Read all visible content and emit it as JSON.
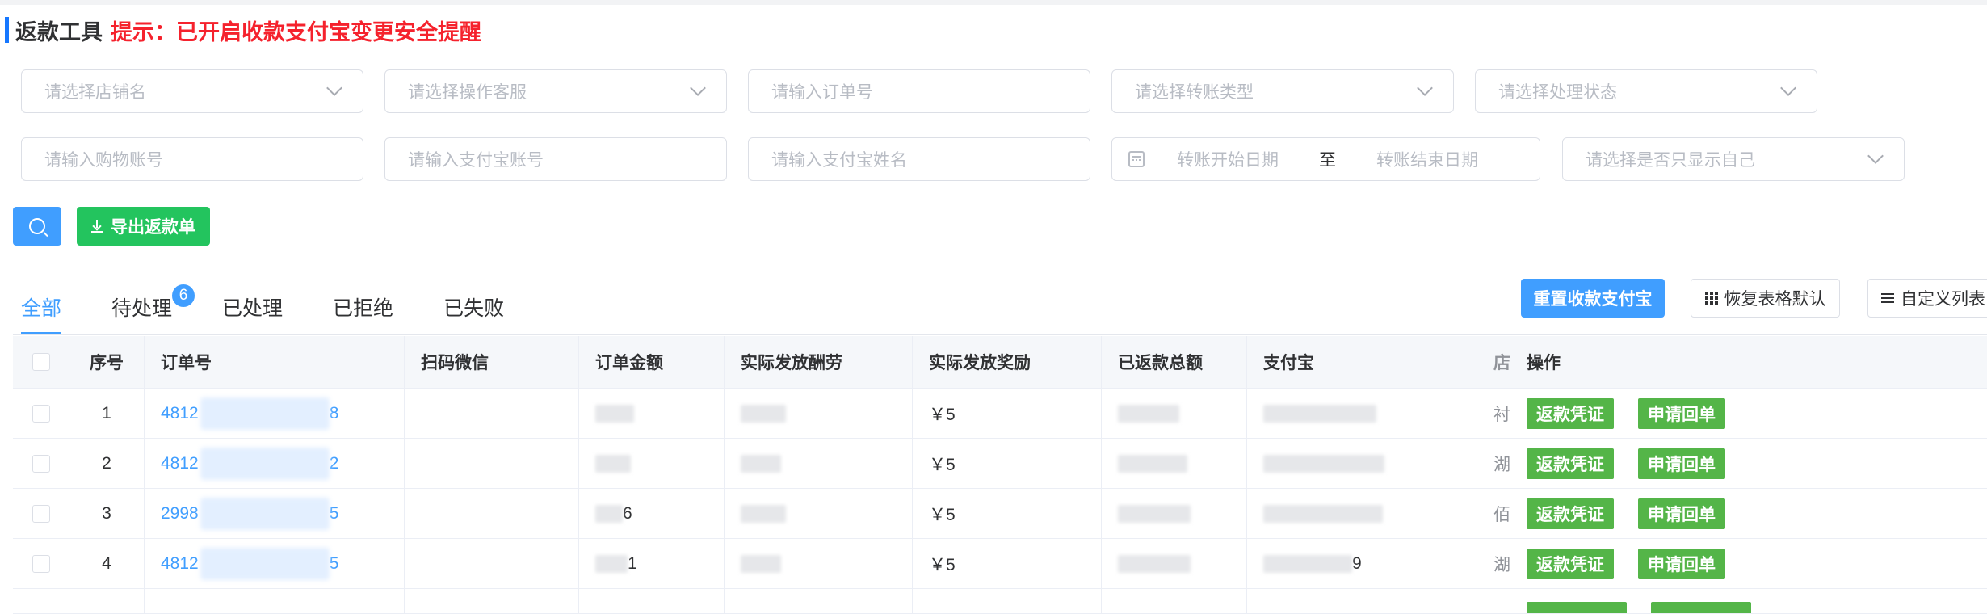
{
  "header": {
    "title": "返款工具",
    "tip": "提示：已开启收款支付宝变更安全提醒"
  },
  "filters": {
    "row1": [
      {
        "name": "shop-select",
        "placeholder": "请选择店铺名",
        "type": "select"
      },
      {
        "name": "operator-select",
        "placeholder": "请选择操作客服",
        "type": "select"
      },
      {
        "name": "order-input",
        "placeholder": "请输入订单号",
        "type": "input"
      },
      {
        "name": "transfer-type-select",
        "placeholder": "请选择转账类型",
        "type": "select"
      },
      {
        "name": "status-select",
        "placeholder": "请选择处理状态",
        "type": "select"
      }
    ],
    "row2": [
      {
        "name": "shopping-account-input",
        "placeholder": "请输入购物账号",
        "type": "input"
      },
      {
        "name": "alipay-account-input",
        "placeholder": "请输入支付宝账号",
        "type": "input"
      },
      {
        "name": "alipay-name-input",
        "placeholder": "请输入支付宝姓名",
        "type": "input"
      }
    ],
    "date_range": {
      "start_placeholder": "转账开始日期",
      "separator": "至",
      "end_placeholder": "转账结束日期"
    },
    "self_only_placeholder": "请选择是否只显示自己"
  },
  "actions": {
    "export_label": "导出返款单",
    "reset_alipay_label": "重置收款支付宝",
    "restore_table_label": "恢复表格默认",
    "custom_list_label": "自定义列表"
  },
  "tabs": [
    {
      "label": "全部",
      "active": true
    },
    {
      "label": "待处理",
      "badge": "6"
    },
    {
      "label": "已处理"
    },
    {
      "label": "已拒绝"
    },
    {
      "label": "已失败"
    }
  ],
  "table": {
    "headers": {
      "index": "序号",
      "order": "订单号",
      "scan": "扫码微信",
      "amount": "订单金额",
      "labor": "实际发放酬劳",
      "reward": "实际发放奖励",
      "total": "已返款总额",
      "alipay": "支付宝",
      "narrow": "店",
      "ops": "操作"
    },
    "rows": [
      {
        "index": "1",
        "order_prefix": "4812",
        "order_suffix": "8",
        "amount_visible": "",
        "reward": "￥5",
        "narrow": "衬"
      },
      {
        "index": "2",
        "order_prefix": "4812",
        "order_suffix": "2",
        "amount_visible": "",
        "reward": "￥5",
        "narrow": "湖"
      },
      {
        "index": "3",
        "order_prefix": "2998",
        "order_suffix": "5",
        "amount_visible": "6",
        "reward": "￥5",
        "narrow": "佰"
      },
      {
        "index": "4",
        "order_prefix": "4812",
        "order_suffix": "5",
        "amount_visible": "1",
        "reward": "￥5",
        "narrow": "湖"
      }
    ],
    "row_ops": {
      "voucher": "返款凭证",
      "receipt": "申请回单"
    },
    "alipay_visible_tail_row4": "9"
  },
  "colors": {
    "primary": "#409eff",
    "success": "#23c45e",
    "op_green": "#54b548",
    "danger": "#f5222d"
  }
}
